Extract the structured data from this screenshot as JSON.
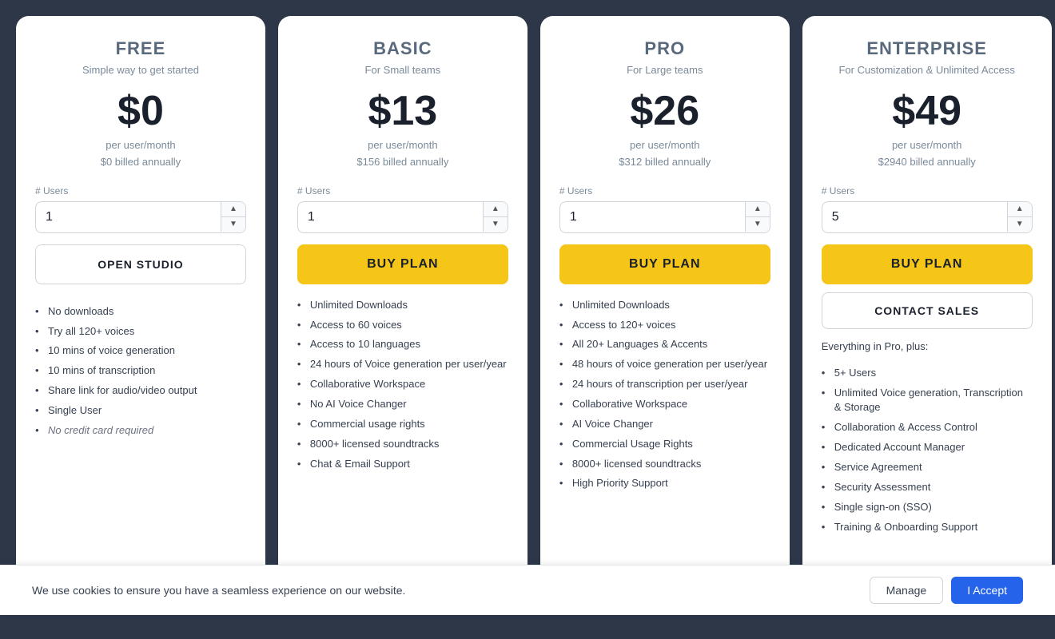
{
  "plans": [
    {
      "id": "free",
      "name": "FREE",
      "tagline": "Simple way to get started",
      "price": "$0",
      "price_sub_line1": "per user/month",
      "price_sub_line2": "$0 billed annually",
      "users_label": "# Users",
      "users_default": "1",
      "cta_type": "outline",
      "cta_label": "OPEN STUDIO",
      "features_header": null,
      "features": [
        {
          "text": "No downloads",
          "italic": false
        },
        {
          "text": "Try all 120+ voices",
          "italic": false
        },
        {
          "text": "10 mins of voice generation",
          "italic": false
        },
        {
          "text": "10 mins of transcription",
          "italic": false
        },
        {
          "text": "Share link for audio/video output",
          "italic": false
        },
        {
          "text": "Single User",
          "italic": false
        },
        {
          "text": "No credit card required",
          "italic": true
        }
      ]
    },
    {
      "id": "basic",
      "name": "BASIC",
      "tagline": "For Small teams",
      "price": "$13",
      "price_sub_line1": "per user/month",
      "price_sub_line2": "$156 billed annually",
      "users_label": "# Users",
      "users_default": "1",
      "cta_type": "primary",
      "cta_label": "BUY PLAN",
      "features_header": null,
      "features": [
        {
          "text": "Unlimited Downloads",
          "italic": false
        },
        {
          "text": "Access to 60 voices",
          "italic": false
        },
        {
          "text": "Access to 10 languages",
          "italic": false
        },
        {
          "text": "24 hours of Voice generation per user/year",
          "italic": false
        },
        {
          "text": "Collaborative Workspace",
          "italic": false
        },
        {
          "text": "No AI Voice Changer",
          "italic": false
        },
        {
          "text": "Commercial usage rights",
          "italic": false
        },
        {
          "text": "8000+ licensed soundtracks",
          "italic": false
        },
        {
          "text": "Chat & Email Support",
          "italic": false
        }
      ]
    },
    {
      "id": "pro",
      "name": "PRO",
      "tagline": "For Large teams",
      "price": "$26",
      "price_sub_line1": "per user/month",
      "price_sub_line2": "$312 billed annually",
      "users_label": "# Users",
      "users_default": "1",
      "cta_type": "primary",
      "cta_label": "BUY PLAN",
      "features_header": null,
      "features": [
        {
          "text": "Unlimited Downloads",
          "italic": false
        },
        {
          "text": "Access to 120+ voices",
          "italic": false
        },
        {
          "text": "All 20+ Languages & Accents",
          "italic": false
        },
        {
          "text": "48 hours of voice generation per user/year",
          "italic": false
        },
        {
          "text": "24 hours of transcription per user/year",
          "italic": false
        },
        {
          "text": "Collaborative Workspace",
          "italic": false
        },
        {
          "text": "AI Voice Changer",
          "italic": false
        },
        {
          "text": "Commercial Usage Rights",
          "italic": false
        },
        {
          "text": "8000+ licensed soundtracks",
          "italic": false
        },
        {
          "text": "High Priority Support",
          "italic": false
        }
      ]
    },
    {
      "id": "enterprise",
      "name": "ENTERPRISE",
      "tagline": "For Customization & Unlimited Access",
      "price": "$49",
      "price_sub_line1": "per user/month",
      "price_sub_line2": "$2940 billed annually",
      "users_label": "# Users",
      "users_default": "5",
      "cta_type": "primary",
      "cta_label": "BUY PLAN",
      "cta2_label": "CONTACT SALES",
      "features_header": "Everything in Pro, plus:",
      "features": [
        {
          "text": "5+ Users",
          "italic": false
        },
        {
          "text": "Unlimited Voice generation, Transcription & Storage",
          "italic": false
        },
        {
          "text": "Collaboration & Access Control",
          "italic": false
        },
        {
          "text": "Dedicated Account Manager",
          "italic": false
        },
        {
          "text": "Service Agreement",
          "italic": false
        },
        {
          "text": "Security Assessment",
          "italic": false
        },
        {
          "text": "Single sign-on (SSO)",
          "italic": false
        },
        {
          "text": "Training & Onboarding Support",
          "italic": false
        }
      ]
    }
  ],
  "cookie": {
    "text": "We use cookies to ensure you have a seamless experience on our website.",
    "manage_label": "Manage",
    "accept_label": "I Accept"
  }
}
